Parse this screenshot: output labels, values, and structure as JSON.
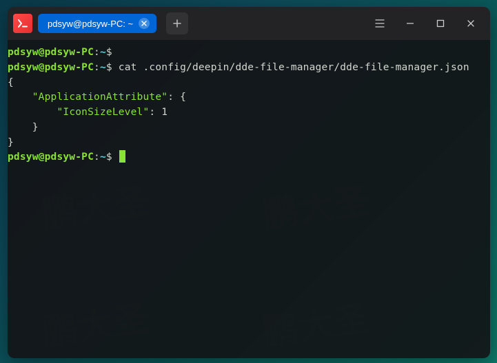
{
  "titlebar": {
    "tab_title": "pdsyw@pdsyw-PC: ~"
  },
  "terminal": {
    "prompt": {
      "user_host": "pdsyw@pdsyw-PC",
      "sep1": ":",
      "cwd": "~",
      "symbol": "$"
    },
    "command": "cat .config/deepin/dde-file-manager/dde-file-manager.json",
    "output": {
      "l1": "{",
      "l2_key": "\"ApplicationAttribute\"",
      "l2_after": ": {",
      "l3_key": "\"IconSizeLevel\"",
      "l3_after": ": ",
      "l3_val": "1",
      "l4": "    }",
      "l5": "}"
    }
  },
  "watermark": {
    "text": "鹏大圣"
  }
}
